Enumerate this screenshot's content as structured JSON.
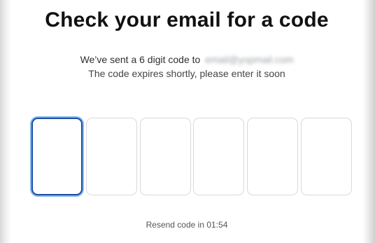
{
  "title": "Check your email for a code",
  "message": {
    "line1_prefix": "We’ve sent a 6 digit code to",
    "email": "email@yopmail.com",
    "line2": "The code expires shortly, please enter it soon"
  },
  "code": {
    "digits": [
      "",
      "",
      "",
      "",
      "",
      ""
    ]
  },
  "resend": {
    "text": "Resend code in 01:54"
  }
}
